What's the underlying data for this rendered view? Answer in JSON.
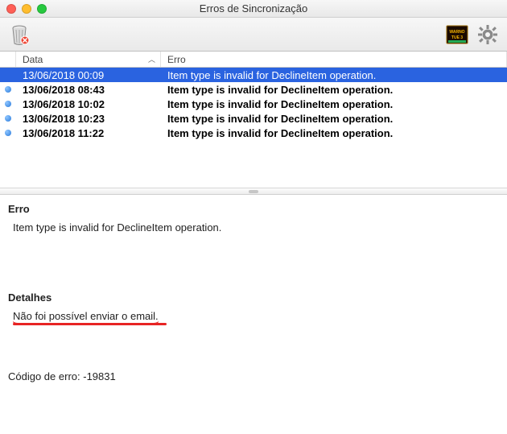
{
  "window": {
    "title": "Erros de Sincronização"
  },
  "columns": {
    "data": "Data",
    "erro": "Erro"
  },
  "rows": [
    {
      "date": "13/06/2018 00:09",
      "error": "Item type is invalid for DeclineItem operation.",
      "selected": true,
      "hasDot": false
    },
    {
      "date": "13/06/2018 08:43",
      "error": "Item type is invalid for DeclineItem operation.",
      "selected": false,
      "hasDot": true
    },
    {
      "date": "13/06/2018 10:02",
      "error": "Item type is invalid for DeclineItem operation.",
      "selected": false,
      "hasDot": true
    },
    {
      "date": "13/06/2018 10:23",
      "error": "Item type is invalid for DeclineItem operation.",
      "selected": false,
      "hasDot": true
    },
    {
      "date": "13/06/2018 11:22",
      "error": "Item type is invalid for DeclineItem operation.",
      "selected": false,
      "hasDot": true
    }
  ],
  "detail": {
    "erro_label": "Erro",
    "erro_text": "Item type is invalid for DeclineItem operation.",
    "detalhes_label": "Detalhes",
    "detalhes_text": "Não foi possível enviar o email.",
    "error_code_label": "Código de erro: ",
    "error_code_value": "-19831"
  },
  "icons": {
    "trash": "trash-delete-icon",
    "log": "log-icon",
    "gear": "gear-icon"
  }
}
